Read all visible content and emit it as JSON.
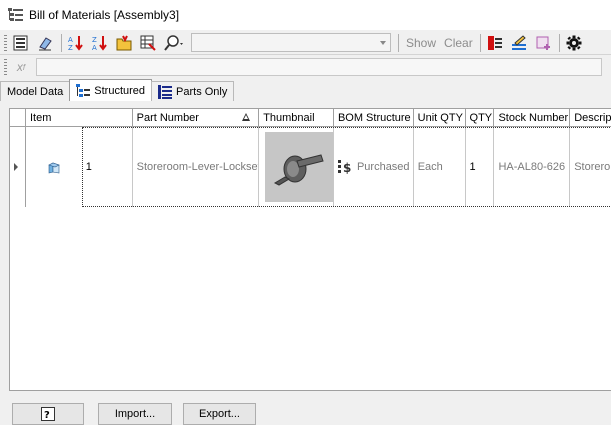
{
  "window": {
    "title": "Bill of Materials [Assembly3]"
  },
  "toolbar": {
    "combo_value": "",
    "show_label": "Show",
    "clear_label": "Clear"
  },
  "tabs": [
    {
      "label": "Model Data"
    },
    {
      "label": "Structured"
    },
    {
      "label": "Parts Only"
    }
  ],
  "table": {
    "columns": [
      "Item",
      "Part Number",
      "Thumbnail",
      "BOM Structure",
      "Unit QTY",
      "QTY",
      "Stock Number",
      "Descrip"
    ],
    "rows": [
      {
        "item": "1",
        "part_number": "Storeroom-Lever-Lockset",
        "bom_structure": "Purchased",
        "unit_qty": "Each",
        "qty": "1",
        "stock_number": "HA-AL80-626",
        "description": "Storero"
      }
    ]
  },
  "buttons": {
    "import": "Import...",
    "export": "Export..."
  },
  "colors": {
    "accent_blue": "#1f6fd1",
    "accent_red": "#d01010"
  }
}
